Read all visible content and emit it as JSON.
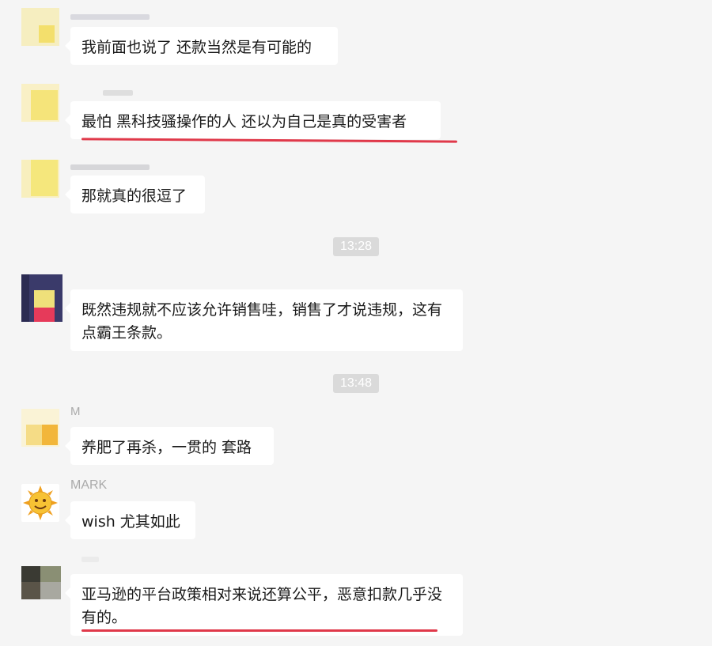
{
  "colors": {
    "background": "#f5f5f5",
    "bubble": "#ffffff",
    "underline": "#e0394a",
    "timestamp_bg": "#dadada"
  },
  "messages": [
    {
      "text": "我前面也说了 还款当然是有可能的"
    },
    {
      "text": "最怕 黑科技骚操作的人 还以为自己是真的受害者"
    },
    {
      "text": "那就真的很逗了"
    },
    {
      "text": "既然违规就不应该允许销售哇，销售了才说违规，这有点霸王条款。"
    },
    {
      "text": "养肥了再杀，一贯的 套路"
    },
    {
      "sender": "MARK",
      "text": "wish 尤其如此",
      "avatar_icon": "sun-emoji-icon"
    },
    {
      "text": "亚马逊的平台政策相对来说还算公平，恶意扣款几乎没有的。"
    }
  ],
  "timestamps": [
    "13:28",
    "13:48"
  ],
  "partial_sender_glyph": "M"
}
